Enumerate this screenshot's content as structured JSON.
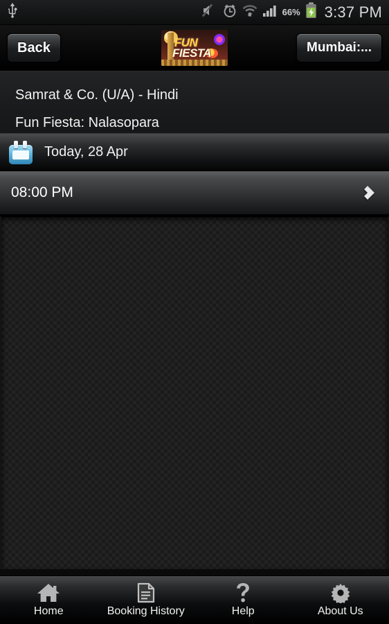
{
  "statusbar": {
    "usb_icon": "usb-icon",
    "mute_icon": "volume-mute-icon",
    "alarm_icon": "alarm-clock-icon",
    "wifi_icon": "wifi-data-icon",
    "signal_icon": "cellular-signal-icon",
    "battery_percent": "66%",
    "battery_icon": "battery-charging-icon",
    "time": "3:37 PM",
    "battery_color": "#8bc34a"
  },
  "header": {
    "back_label": "Back",
    "city_label": "Mumbai:...",
    "logo": {
      "name": "fun-fiesta-logo",
      "line1": "FUN",
      "line2": "FIESTA"
    }
  },
  "info": {
    "movie_line": "Samrat & Co. (U/A) - Hindi",
    "venue_line": "Fun Fiesta: Nalasopara"
  },
  "date_row": {
    "icon": "calendar-icon",
    "label": "Today, 28 Apr"
  },
  "showtimes": [
    {
      "time": "08:00 PM",
      "chevron": "chevron-right-icon"
    }
  ],
  "navbar": {
    "items": [
      {
        "label": "Home",
        "icon": "home-icon"
      },
      {
        "label": "Booking History",
        "icon": "document-icon"
      },
      {
        "label": "Help",
        "icon": "question-mark-icon"
      },
      {
        "label": "About Us",
        "icon": "gear-icon"
      }
    ]
  }
}
